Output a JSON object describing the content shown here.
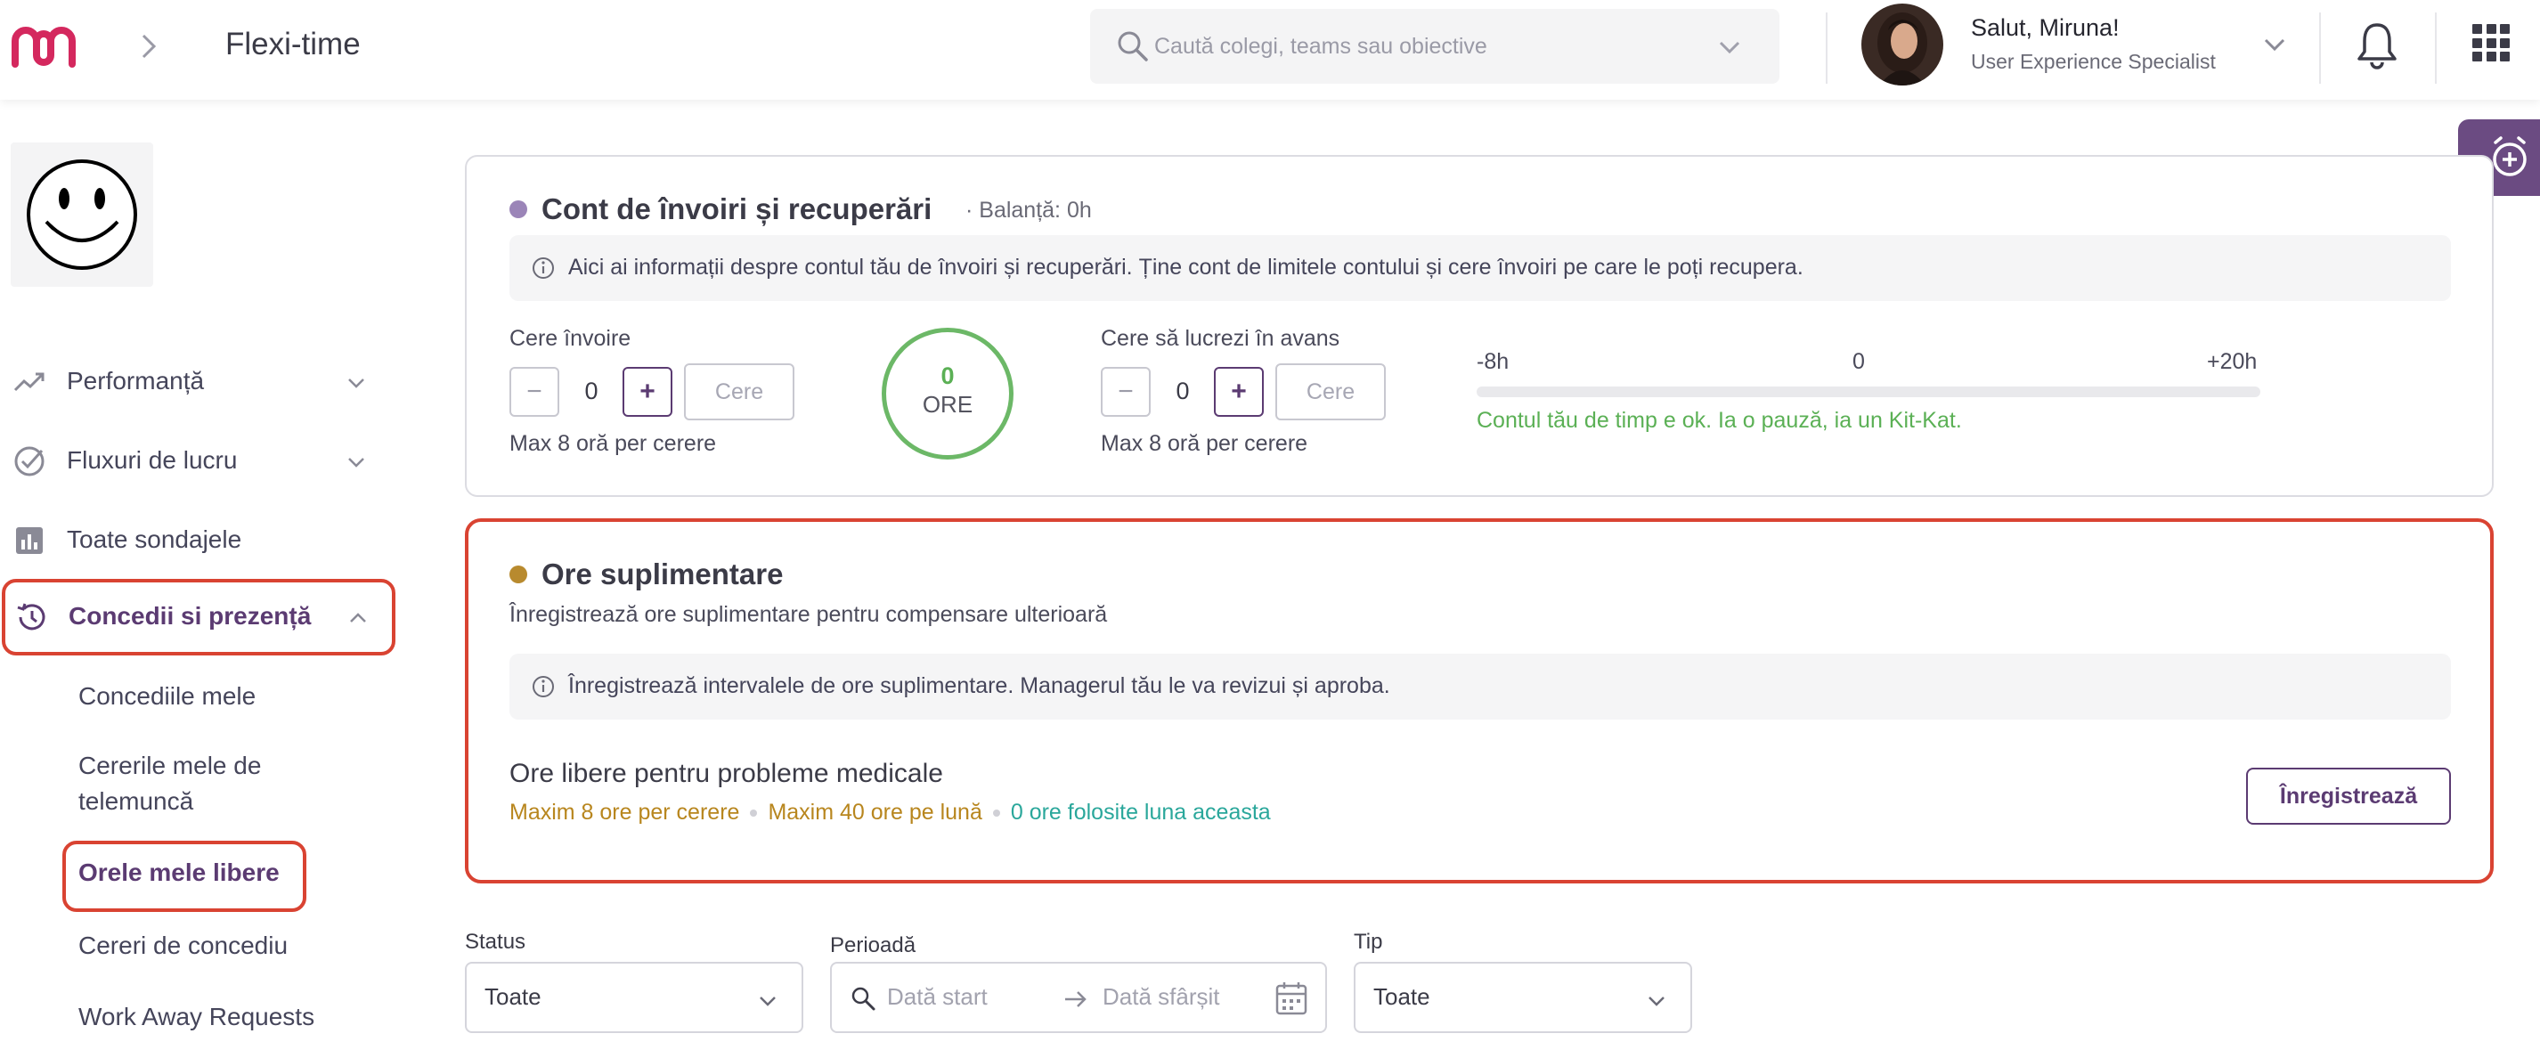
{
  "header": {
    "app_title": "Flexi-time",
    "search_placeholder": "Caută colegi, teams sau obiective",
    "user_greeting": "Salut, Miruna!",
    "user_role": "User Experience Specialist"
  },
  "sidebar": {
    "items": [
      {
        "label": "Performanță",
        "icon": "trend-icon",
        "expandable": true
      },
      {
        "label": "Fluxuri de lucru",
        "icon": "check-circle-icon",
        "expandable": true
      },
      {
        "label": "Toate sondajele",
        "icon": "bar-chart-icon",
        "expandable": false
      },
      {
        "label": "Concedii si prezență",
        "icon": "history-icon",
        "expandable": true,
        "expanded": true
      }
    ],
    "sub_items": [
      "Concediile mele",
      "Cererile mele de",
      "telemuncă",
      "Orele mele libere",
      "Cereri de concediu",
      "Work Away Requests"
    ]
  },
  "account": {
    "title": "Cont de învoiri și recuperări",
    "balance": "· Balanță: 0h",
    "info": "Aici ai informații despre contul tău de învoiri și recuperări. Ține cont de limitele contului și cere învoiri pe care le poți recupera.",
    "request_label": "Cere învoire",
    "request_value": "0",
    "request_button": "Cere",
    "request_hint": "Max 8 oră per cerere",
    "ring_value": "0",
    "ring_unit": "ORE",
    "advance_label": "Cere să lucrezi în avans",
    "advance_value": "0",
    "advance_button": "Cere",
    "advance_hint": "Max 8 oră per cerere",
    "scale_min": "-8h",
    "scale_mid": "0",
    "scale_max": "+20h",
    "status_text": "Contul tău de timp e ok. Ia o pauză, ia un Kit-Kat."
  },
  "overtime": {
    "title": "Ore suplimentare",
    "subtitle": "Înregistrează ore suplimentare pentru compensare ulterioară",
    "info": "Înregistrează intervalele de ore suplimentare. Managerul tău le va revizui și aproba.",
    "section_title": "Ore libere pentru probleme medicale",
    "meta_1": "Maxim 8 ore per cerere",
    "meta_2": "Maxim 40 ore pe lună",
    "meta_3": "0 ore folosite luna aceasta",
    "register_button": "Înregistrează"
  },
  "filters": {
    "status_label": "Status",
    "status_value": "Toate",
    "period_label": "Perioadă",
    "start_placeholder": "Dată start",
    "end_placeholder": "Dată sfârșit",
    "type_label": "Tip",
    "type_value": "Toate"
  },
  "colors": {
    "brand": "#5b3b72",
    "highlight": "#d94332",
    "success": "#5bb055",
    "overtime_dot": "#b88a2e",
    "meta_gold": "#b8861e",
    "meta_teal": "#2aa79b",
    "account_dot": "#9b85b8"
  }
}
